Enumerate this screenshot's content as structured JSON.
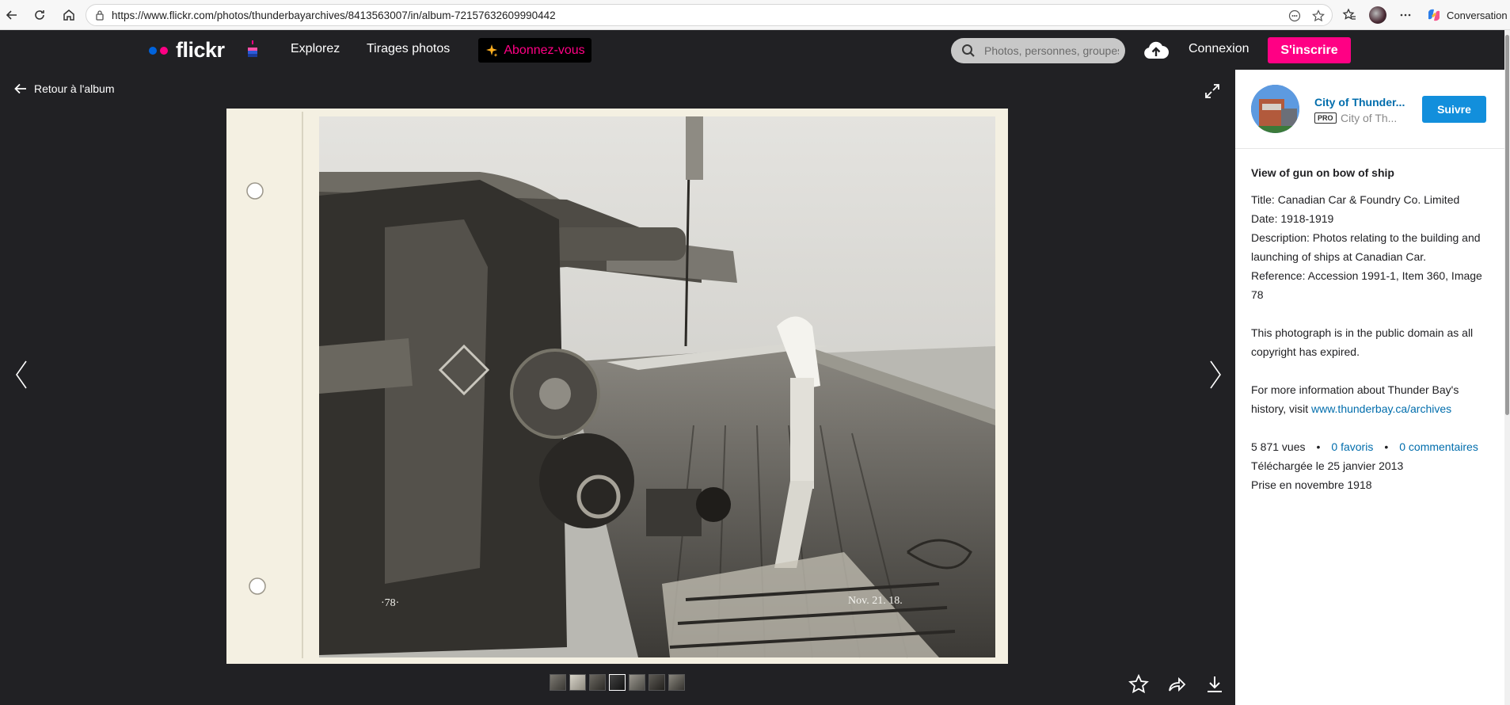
{
  "browser": {
    "url": "https://www.flickr.com/photos/thunderbayarchives/8413563007/in/album-72157632609990442",
    "copilot_label": "Conversation"
  },
  "header": {
    "logo_text": "flickr",
    "nav_explore": "Explorez",
    "nav_prints": "Tirages photos",
    "subscribe_label": "Abonnez-vous",
    "search_placeholder": "Photos, personnes, groupes",
    "login": "Connexion",
    "signup": "S'inscrire",
    "colors": {
      "flickr_blue": "#0063dc",
      "flickr_pink": "#ff0084"
    }
  },
  "viewer": {
    "back_label": "Retour à l'album",
    "photo_annotation_left": "·78·",
    "photo_annotation_right": "Nov. 21. 18."
  },
  "owner": {
    "name": "City of Thunder...",
    "pro": "PRO",
    "sub": "City of Th...",
    "follow": "Suivre"
  },
  "details": {
    "title": "View of gun on bow of ship",
    "line_title": "Title: Canadian Car & Foundry Co. Limited",
    "line_date": "Date: 1918-1919",
    "line_description": "Description: Photos relating to the building and launching of ships at Canadian Car.",
    "line_reference": "Reference: Accession 1991-1, Item 360, Image 78",
    "public_domain": "This photograph is in the public domain as all copyright has expired.",
    "more_info_prefix": "For more information about Thunder Bay's history, visit",
    "more_info_link": "www.thunderbay.ca/archives"
  },
  "stats": {
    "views": "5 871 vues",
    "favs": "0 favoris",
    "comments": "0 commentaires",
    "uploaded": "Téléchargée le 25 janvier 2013",
    "taken": "Prise en novembre 1918",
    "separator": "•"
  }
}
